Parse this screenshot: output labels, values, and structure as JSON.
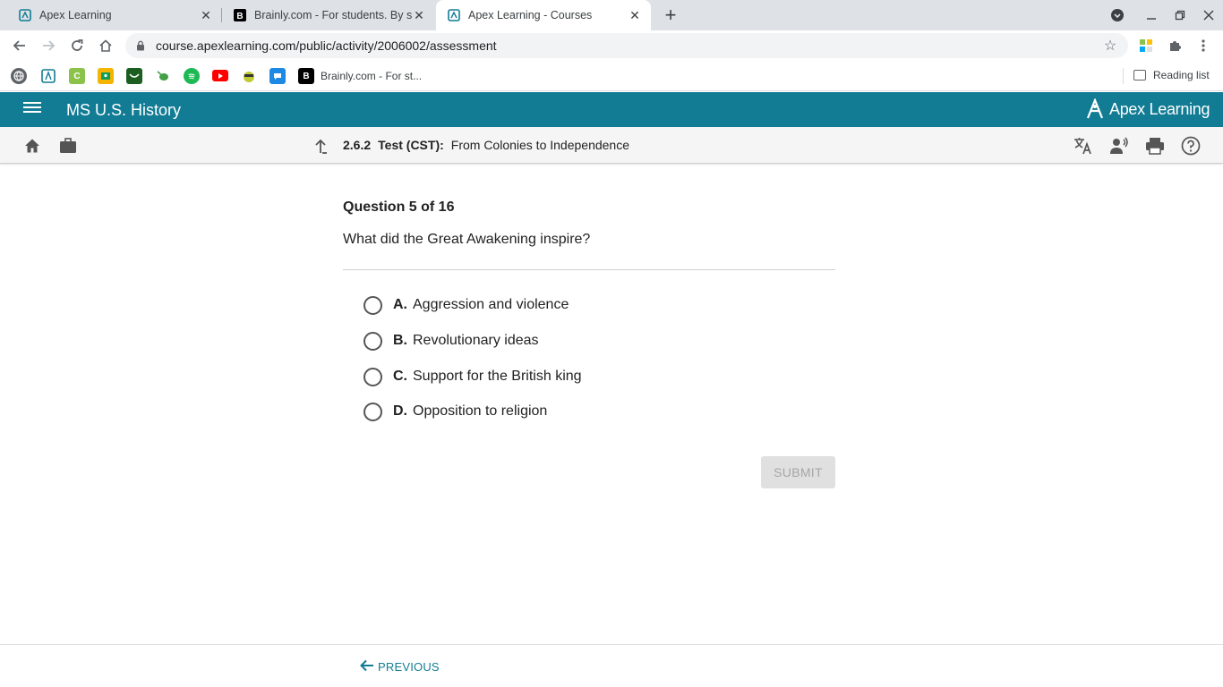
{
  "browser": {
    "tabs": [
      {
        "title": "Apex Learning",
        "active": false
      },
      {
        "title": "Brainly.com - For students. By st",
        "active": false
      },
      {
        "title": "Apex Learning - Courses",
        "active": true
      }
    ],
    "url": "course.apexlearning.com/public/activity/2006002/assessment",
    "bookmark_label": "Brainly.com - For st...",
    "reading_list": "Reading list"
  },
  "app": {
    "course_title": "MS U.S. History",
    "logo_text": "Apex Learning",
    "brand_color": "#127c94"
  },
  "breadcrumb": {
    "number": "2.6.2",
    "kind": "Test (CST):",
    "title": "From Colonies to Independence"
  },
  "question": {
    "counter": "Question 5 of 16",
    "prompt": "What did the Great Awakening inspire?",
    "choices": [
      {
        "letter": "A.",
        "text": "Aggression and violence"
      },
      {
        "letter": "B.",
        "text": "Revolutionary ideas"
      },
      {
        "letter": "C.",
        "text": "Support for the British king"
      },
      {
        "letter": "D.",
        "text": "Opposition to religion"
      }
    ],
    "submit_label": "SUBMIT"
  },
  "footer": {
    "previous_label": "PREVIOUS"
  }
}
